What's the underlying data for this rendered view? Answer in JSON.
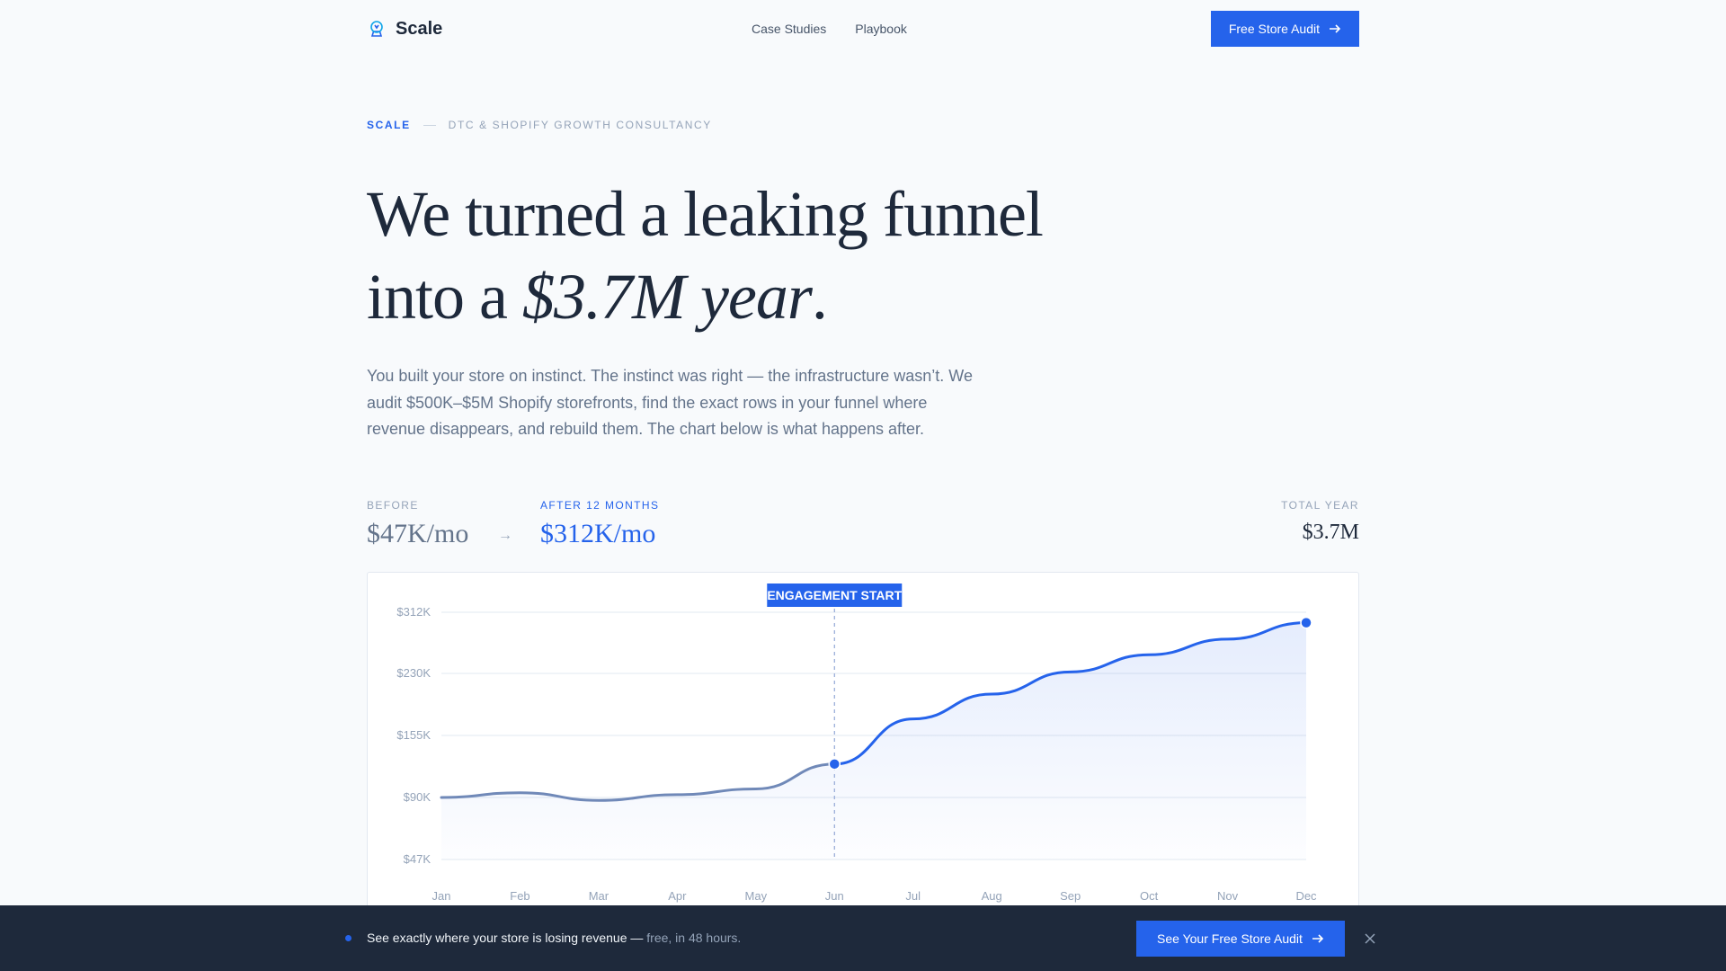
{
  "nav": {
    "brand": "Scale",
    "links": [
      "Case Studies",
      "Playbook"
    ],
    "cta": "Free Store Audit"
  },
  "eyebrow": {
    "brand": "SCALE",
    "text": "DTC & SHOPIFY GROWTH CONSULTANCY"
  },
  "hero": {
    "line1": "We turned a leaking funnel",
    "line2_prefix": "into a ",
    "line2_emphasis": "$3.7M year",
    "line2_suffix": ".",
    "lede": "You built your store on instinct. The instinct was right — the infrastructure wasn’t. We audit $500K–$5M Shopify storefronts, find the exact rows in your funnel where revenue disappears, and rebuild them. The chart below is what happens after."
  },
  "stats": {
    "before_label": "BEFORE",
    "before_value": "$47K/mo",
    "arrow": "→",
    "after_label": "AFTER 12 MONTHS",
    "after_value": "$312K/mo",
    "total_label": "TOTAL YEAR",
    "total_value": "$3.7M"
  },
  "colors": {
    "accent": "#2563eb",
    "line_before": "#7089b8",
    "bar_bg": "#1e293b"
  },
  "chart_data": {
    "type": "line",
    "x": [
      "Jan",
      "Feb",
      "Mar",
      "Apr",
      "May",
      "Jun",
      "Jul",
      "Aug",
      "Sep",
      "Oct",
      "Nov",
      "Dec"
    ],
    "series": [
      {
        "values": [
          90,
          95,
          88,
          93,
          99,
          125,
          175,
          205,
          232,
          255,
          276,
          298
        ]
      }
    ],
    "yticks": [
      47,
      90,
      155,
      230,
      312
    ],
    "ytick_labels": [
      "$47K",
      "$90K",
      "$155K",
      "$230K",
      "$312K"
    ],
    "annotation": {
      "label": "ENGAGEMENT START",
      "x": "Jun"
    },
    "grid": true
  },
  "bottom_bar": {
    "text": "See exactly where your store is losing revenue —",
    "subtext": " free, in 48 hours.",
    "cta": "See Your Free Store Audit"
  }
}
